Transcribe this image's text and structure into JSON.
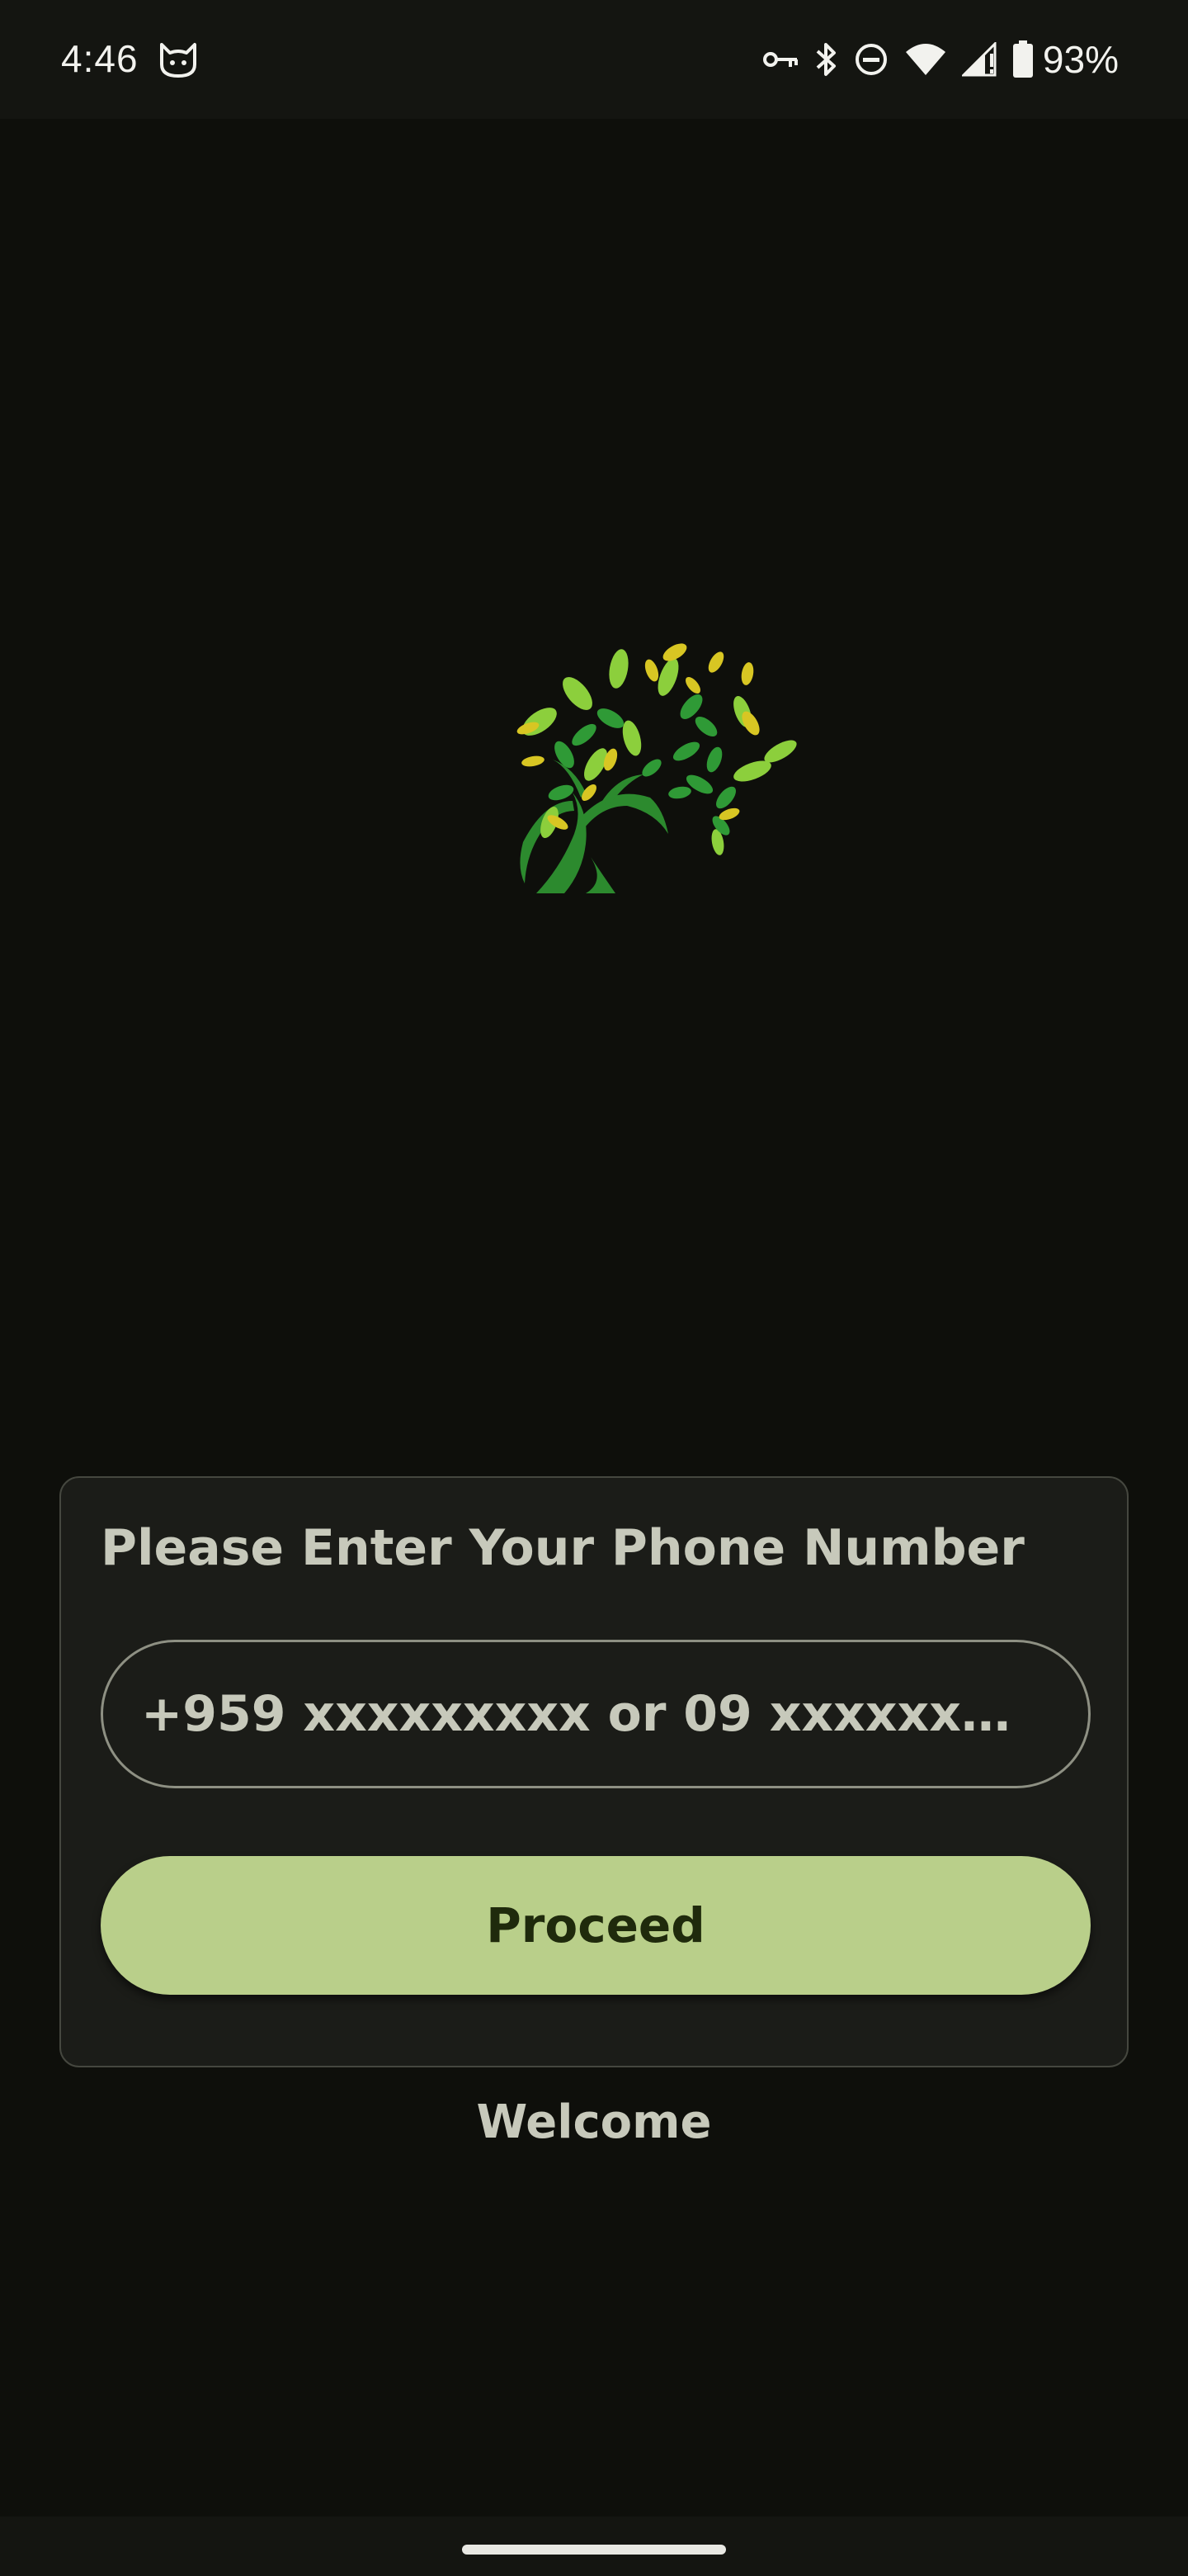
{
  "status_bar": {
    "time": "4:46",
    "battery_percent": "93%",
    "icons": [
      "cat-icon",
      "vpn-key-icon",
      "bluetooth-icon",
      "do-not-disturb-icon",
      "wifi-icon",
      "cell-signal-icon",
      "battery-icon"
    ]
  },
  "logo": {
    "icon": "tree-logo-icon"
  },
  "login_card": {
    "title": "Please Enter Your Phone Number",
    "phone_input": {
      "value": "",
      "placeholder": "+959 xxxxxxxxx or 09 xxxxxx…"
    },
    "proceed_label": "Proceed"
  },
  "welcome_text": "Welcome",
  "colors": {
    "background": "#0e0f0b",
    "card": "#1b1c18",
    "accent": "#b9cf8a",
    "text": "#c7c9bb"
  }
}
